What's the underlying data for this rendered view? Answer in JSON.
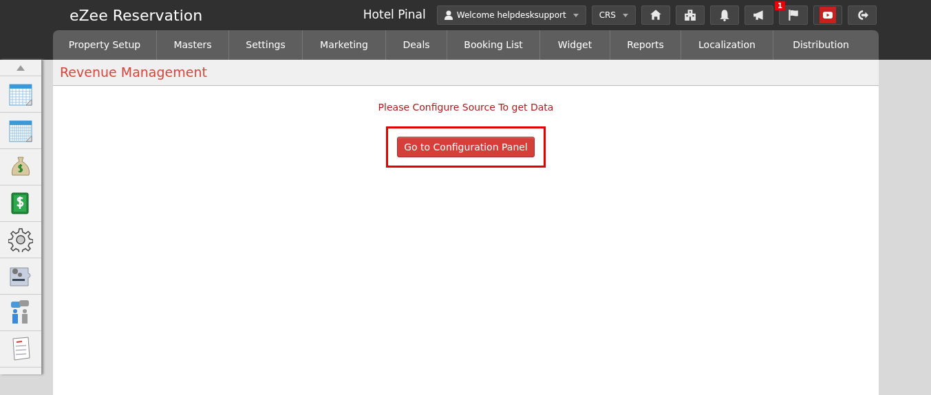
{
  "app": {
    "title": "eZee Reservation",
    "hotel": "Hotel Pinal"
  },
  "user_menu": {
    "label": "Welcome helpdesksupport"
  },
  "mode_menu": {
    "label": "CRS"
  },
  "toolbar": [
    {
      "kind": "home"
    },
    {
      "kind": "hotels"
    },
    {
      "kind": "bell"
    },
    {
      "kind": "megaphone"
    },
    {
      "kind": "flag",
      "badge": "1"
    },
    {
      "kind": "video"
    },
    {
      "kind": "logout"
    }
  ],
  "nav": [
    {
      "label": "Property Setup"
    },
    {
      "label": "Masters"
    },
    {
      "label": "Settings"
    },
    {
      "label": "Marketing"
    },
    {
      "label": "Deals"
    },
    {
      "label": "Booking List"
    },
    {
      "label": "Widget"
    },
    {
      "label": "Reports"
    },
    {
      "label": "Localization"
    },
    {
      "label": "Distribution"
    }
  ],
  "sidebar": [
    {
      "kind": "calendar"
    },
    {
      "kind": "calendar-year"
    },
    {
      "kind": "money-bag"
    },
    {
      "kind": "dollar"
    },
    {
      "kind": "gear"
    },
    {
      "kind": "widget"
    },
    {
      "kind": "users"
    },
    {
      "kind": "list"
    }
  ],
  "page": {
    "title": "Revenue Management",
    "message": "Please Configure Source To get Data",
    "button": "Go to Configuration Panel",
    "highlighted": true
  }
}
